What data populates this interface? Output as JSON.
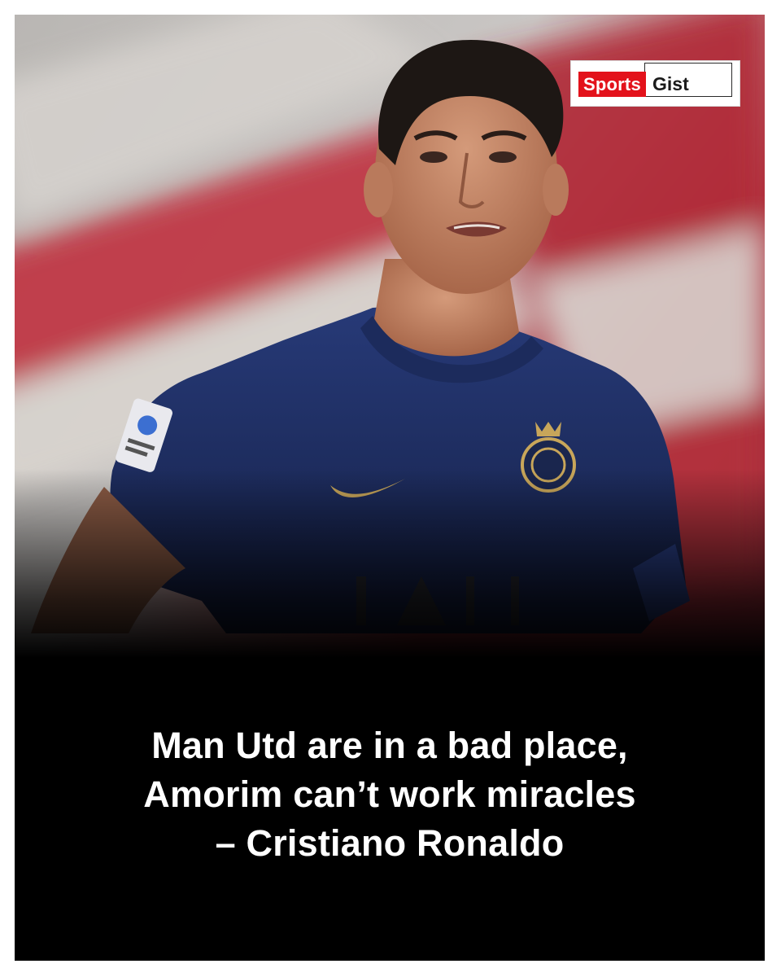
{
  "brand": {
    "word1": "Sports",
    "word2": "Gist",
    "accent_color": "#e3121b"
  },
  "photo": {
    "subject": "footballer-in-navy-kit"
  },
  "headline": {
    "line1": "Man Utd are in a bad place,",
    "line2": "Amorim can’t work miracles",
    "line3": "– Cristiano Ronaldo"
  }
}
